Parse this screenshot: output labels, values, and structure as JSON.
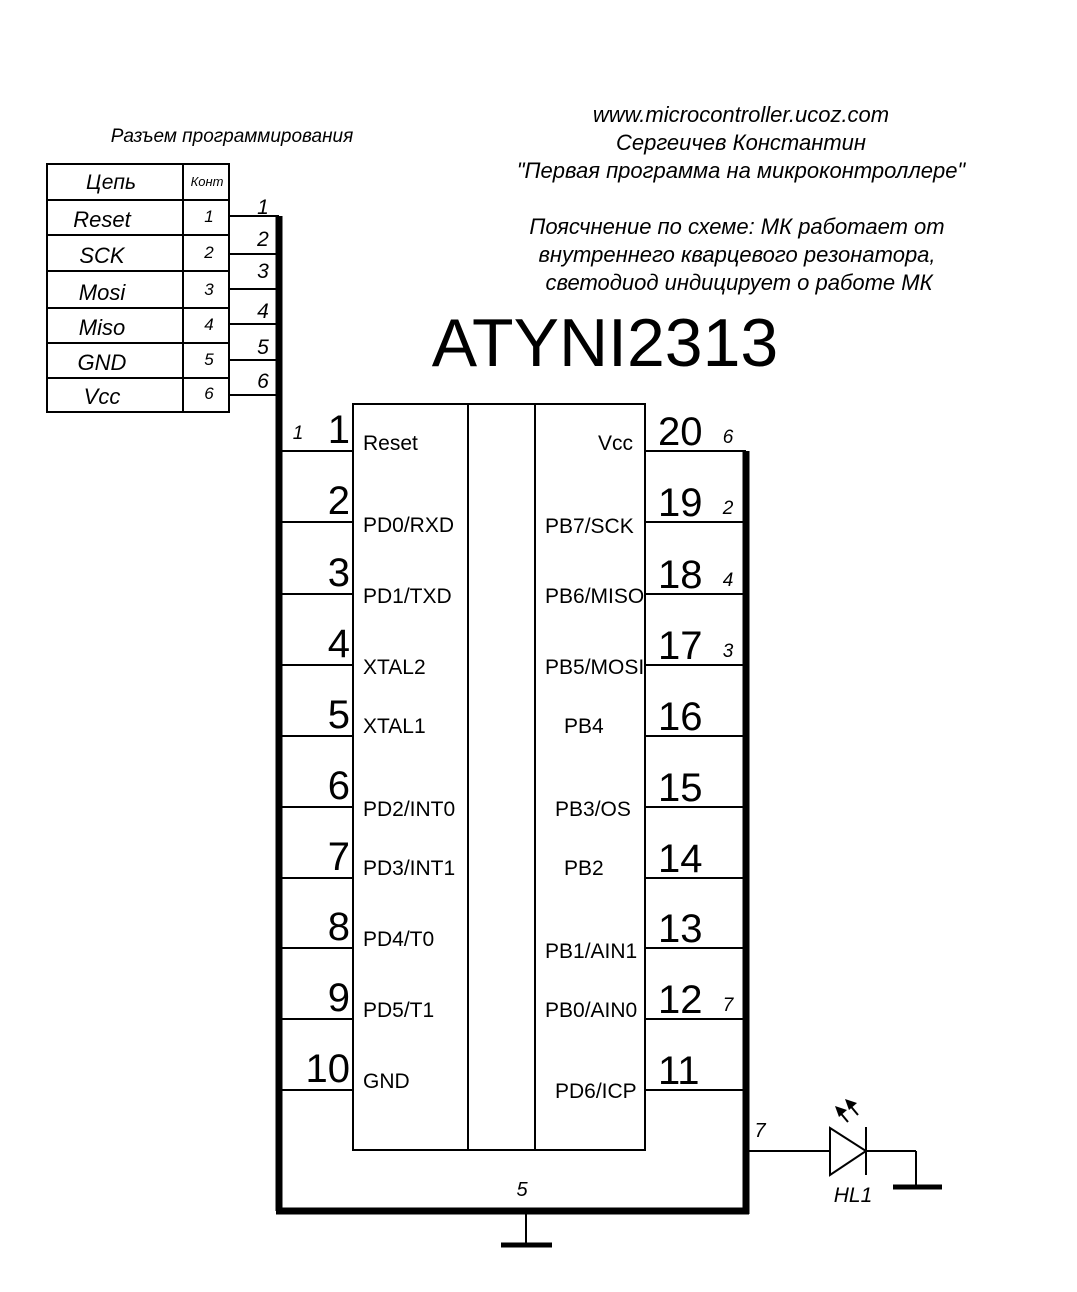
{
  "header": {
    "website": "www.microcontroller.ucoz.com",
    "author": "Сергеичев Константин",
    "project": "\"Первая программа на микроконтроллере\"",
    "note_lines": [
      "Поясчнение по схеме: МК работает от",
      "внутреннего кварцевого резонатора,",
      "светодиод индицирует о работе МК"
    ]
  },
  "chip": {
    "name": "ATYNI2313",
    "left_pins": [
      {
        "num": "1",
        "label": "Reset",
        "net": "1"
      },
      {
        "num": "2",
        "label": "PD0/RXD",
        "net": ""
      },
      {
        "num": "3",
        "label": "PD1/TXD",
        "net": ""
      },
      {
        "num": "4",
        "label": "XTAL2",
        "net": ""
      },
      {
        "num": "5",
        "label": "XTAL1",
        "net": ""
      },
      {
        "num": "6",
        "label": "PD2/INT0",
        "net": ""
      },
      {
        "num": "7",
        "label": "PD3/INT1",
        "net": ""
      },
      {
        "num": "8",
        "label": "PD4/T0",
        "net": ""
      },
      {
        "num": "9",
        "label": "PD5/T1",
        "net": ""
      },
      {
        "num": "10",
        "label": "GND",
        "net": ""
      }
    ],
    "right_pins": [
      {
        "num": "20",
        "label": "Vcc",
        "net": "6"
      },
      {
        "num": "19",
        "label": "PB7/SCK",
        "net": "2"
      },
      {
        "num": "18",
        "label": "PB6/MISO",
        "net": "4"
      },
      {
        "num": "17",
        "label": "PB5/MOSI",
        "net": "3"
      },
      {
        "num": "16",
        "label": "PB4",
        "net": ""
      },
      {
        "num": "15",
        "label": "PB3/OS",
        "net": ""
      },
      {
        "num": "14",
        "label": "PB2",
        "net": ""
      },
      {
        "num": "13",
        "label": "PB1/AIN1",
        "net": ""
      },
      {
        "num": "12",
        "label": "PB0/AIN0",
        "net": "7"
      },
      {
        "num": "11",
        "label": "PD6/ICP",
        "net": ""
      }
    ]
  },
  "connector": {
    "title": "Разъем программирования",
    "col_headers": [
      "Цепь",
      "Конт"
    ],
    "rows": [
      {
        "net": "Reset",
        "pin": "1"
      },
      {
        "net": "SCK",
        "pin": "2"
      },
      {
        "net": "Mosi",
        "pin": "3"
      },
      {
        "net": "Miso",
        "pin": "4"
      },
      {
        "net": "GND",
        "pin": "5"
      },
      {
        "net": "Vcc",
        "pin": "6"
      }
    ],
    "wire_labels": [
      "1",
      "2",
      "3",
      "4",
      "5",
      "6"
    ]
  },
  "nets": {
    "gnd_bus_label": "5",
    "led_net_label": "7"
  },
  "led": {
    "ref": "HL1"
  }
}
